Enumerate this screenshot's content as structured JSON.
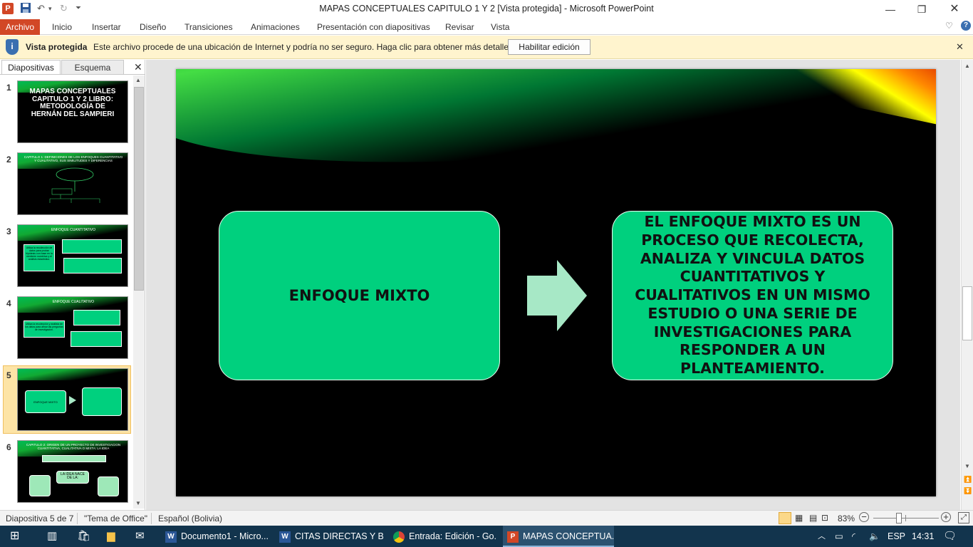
{
  "window": {
    "title": "MAPAS CONCEPTUALES CAPITULO 1 Y 2 [Vista protegida]  -  Microsoft PowerPoint",
    "app_icon": "P"
  },
  "ribbon": {
    "file_tab": "Archivo",
    "tabs": [
      "Inicio",
      "Insertar",
      "Diseño",
      "Transiciones",
      "Animaciones",
      "Presentación con diapositivas",
      "Revisar",
      "Vista"
    ]
  },
  "protected_view": {
    "label": "Vista protegida",
    "message": "Este archivo procede de una ubicación de Internet y podría no ser seguro. Haga clic para obtener más detalles.",
    "button": "Habilitar edición"
  },
  "panel": {
    "tabs": [
      "Diapositivas",
      "Esquema"
    ],
    "thumbnails": [
      {
        "num": "1",
        "title": "MAPAS CONCEPTUALES CAPITULO 1 Y 2 LIBRO: METODOLOGÍA DE HERNÁN DEL SAMPIERI"
      },
      {
        "num": "2",
        "title": "CAPITULO 1: DEFINICIONES DE LOS ENFOQUES CUANTITATIVO Y CUALITATIVO, SUS SIMILITUDES Y DIFERENCIAS"
      },
      {
        "num": "3",
        "title": "ENFOQUE CUANTITATIVO"
      },
      {
        "num": "4",
        "title": "ENFOQUE CUALITATIVO"
      },
      {
        "num": "5",
        "title": "ENFOQUE MIXTO"
      },
      {
        "num": "6",
        "title": "CAPITULO 2: ORIGEN DE UN PROYECTO DE INVESTIGACION CUANTITATIVA, CUALITATIVA O MIXTA: LA IDEA"
      }
    ],
    "thumb3_box": "Utiliza la recolección de datos para probar hipótesis con base en la medición numérica y el análisis estadístico.",
    "thumb4_box": "Utiliza la recolección y análisis de los datos para afinar las preguntas de investigación.",
    "thumb6_idea": "LA IDEA NACE DE LA:",
    "selected_index": 4
  },
  "slide": {
    "left_box": "ENFOQUE MIXTO",
    "right_box": "EL ENFOQUE MIXTO ES UN PROCESO QUE RECOLECTA, ANALIZA Y VINCULA DATOS CUANTITATIVOS Y CUALITATIVOS EN UN MISMO ESTUDIO O UNA SERIE DE INVESTIGACIONES PARA RESPONDER A UN PLANTEAMIENTO.",
    "arrow_color": "#a7e8c6",
    "box_color": "#00d07e"
  },
  "status": {
    "slide_info": "Diapositiva 5 de 7",
    "theme": "\"Tema de Office\"",
    "language": "Español (Bolivia)",
    "zoom": "83%",
    "zoom_level_percent": 83
  },
  "taskbar": {
    "items": [
      {
        "label": "Documento1 - Micro...",
        "icon": "W"
      },
      {
        "label": "CITAS DIRECTAS Y BI...",
        "icon": "W"
      },
      {
        "label": "Entrada: Edición - Go...",
        "icon": "chrome"
      },
      {
        "label": "MAPAS CONCEPTUA...",
        "icon": "P"
      }
    ],
    "lang": "ESP",
    "time": "14:31"
  },
  "colors": {
    "accent": "#d24726",
    "protected_bar": "#fff4ce",
    "taskbar": "#12344d"
  }
}
